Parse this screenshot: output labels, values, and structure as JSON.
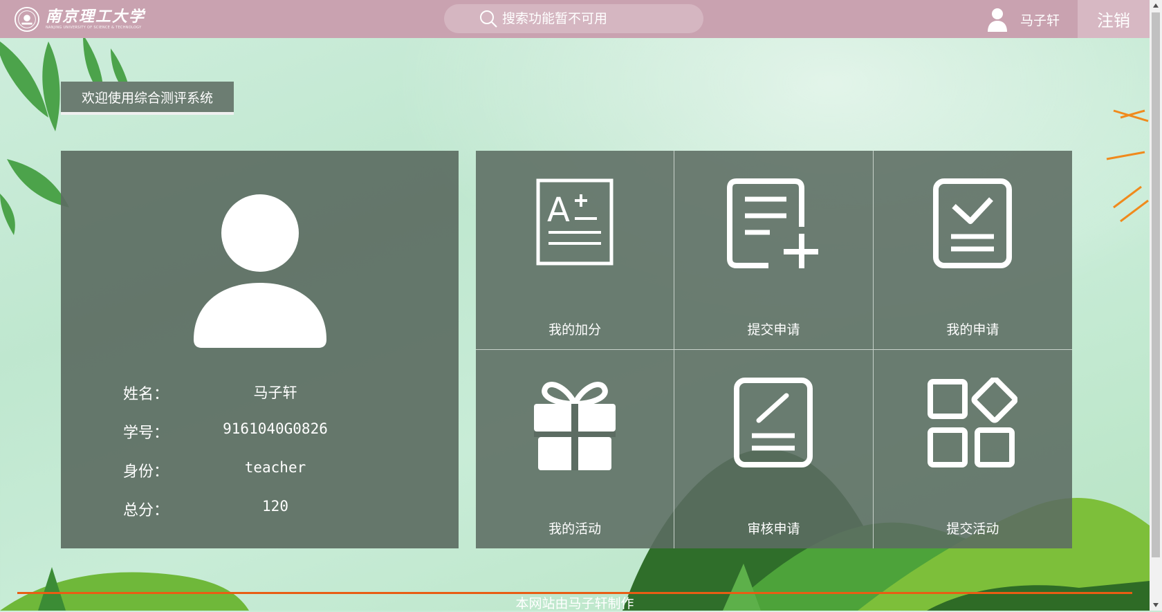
{
  "header": {
    "logo_cn": "南京理工大学",
    "logo_en": "NANJING UNIVERSITY OF SCIENCE & TECHNOLOGY",
    "search_placeholder": "搜索功能暂不可用",
    "user_name": "马子轩",
    "logout_label": "注销"
  },
  "welcome": "欢迎使用综合测评系统",
  "profile": {
    "rows": [
      {
        "label": "姓名：",
        "value": "马子轩"
      },
      {
        "label": "学号：",
        "value": "9161040G0826"
      },
      {
        "label": "身份：",
        "value": "teacher"
      },
      {
        "label": "总分：",
        "value": "120"
      }
    ]
  },
  "menu": [
    {
      "label": "我的加分",
      "icon": "grade-a-plus-icon"
    },
    {
      "label": "提交申请",
      "icon": "document-add-icon"
    },
    {
      "label": "我的申请",
      "icon": "document-check-icon"
    },
    {
      "label": "我的活动",
      "icon": "gift-icon"
    },
    {
      "label": "审核申请",
      "icon": "document-edit-icon"
    },
    {
      "label": "提交活动",
      "icon": "apps-icon"
    }
  ],
  "footer": "本网站由马子轩制作",
  "colors": {
    "header": "#c9a2b0",
    "logout": "#d7b8c3",
    "panel": "#5c6c62",
    "footer_line": "#e85d14"
  }
}
